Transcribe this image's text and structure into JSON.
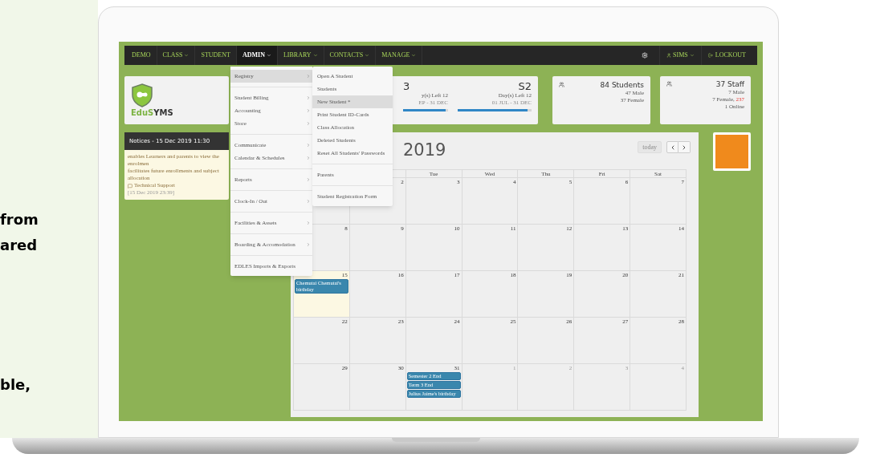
{
  "marketing_text": [
    "from",
    "ared",
    "ble,"
  ],
  "nav": {
    "items": [
      {
        "label": "DEMO",
        "dropdown": false,
        "selected": false
      },
      {
        "label": "CLASS",
        "dropdown": true,
        "selected": false
      },
      {
        "label": "STUDENT",
        "dropdown": false,
        "selected": false
      },
      {
        "label": "ADMIN",
        "dropdown": true,
        "selected": true
      },
      {
        "label": "LIBRARY",
        "dropdown": true,
        "selected": false
      },
      {
        "label": "CONTACTS",
        "dropdown": true,
        "selected": false
      },
      {
        "label": "MANAGE",
        "dropdown": true,
        "selected": false
      }
    ],
    "user": "SIMS",
    "logout": "LOCKOUT"
  },
  "logo_text_parts": [
    "EduS",
    "YMS"
  ],
  "semesters": [
    {
      "name": "3",
      "days_left": "y(s) Left 12",
      "range": "EP - 31 DEC",
      "level": 0.95
    },
    {
      "name": "S2",
      "days_left": "Day(s) Left 12",
      "range": "01 JUL - 31 DEC",
      "level": 0.95
    }
  ],
  "students": {
    "title": "84 Students",
    "lines": [
      "47 Male",
      "37 Female"
    ]
  },
  "staff": {
    "title": "37 Staff",
    "male": "7 Male",
    "female": "7 Female,",
    "female_alert": "237",
    "online": "1 Online"
  },
  "notices": {
    "title": "Notices - 15 Dec 2019 11:30",
    "lines": [
      "enables Learners and parents to view the enrolmen",
      "facilitates future enrollments and subject allocation"
    ],
    "author": "Technical Support",
    "time": "[15 Dec 2019 23:39]"
  },
  "calendar": {
    "title": "2019",
    "today_button": "today",
    "weekdays": [
      "Tue",
      "Wed",
      "Thu",
      "Fri",
      "Sat"
    ],
    "weeks": [
      [
        {
          "day": "2",
          "today": false,
          "muted": false
        },
        {
          "day": "3",
          "today": false,
          "muted": false
        },
        {
          "day": "4",
          "today": false,
          "muted": false
        },
        {
          "day": "5",
          "today": false,
          "muted": false
        },
        {
          "day": "6",
          "today": false,
          "muted": false
        },
        {
          "day": "7",
          "today": false,
          "muted": false
        }
      ],
      [
        {
          "day": "8",
          "today": false,
          "muted": false
        },
        {
          "day": "9",
          "today": false,
          "muted": false
        },
        {
          "day": "10",
          "today": false,
          "muted": false
        },
        {
          "day": "11",
          "today": false,
          "muted": false
        },
        {
          "day": "12",
          "today": false,
          "muted": false
        },
        {
          "day": "13",
          "today": false,
          "muted": false
        },
        {
          "day": "14",
          "today": false,
          "muted": false
        }
      ],
      [
        {
          "day": "15",
          "today": true,
          "muted": false,
          "events": [
            "Chemutai Chemutai's birthday"
          ]
        },
        {
          "day": "16",
          "today": false,
          "muted": false
        },
        {
          "day": "17",
          "today": false,
          "muted": false
        },
        {
          "day": "18",
          "today": false,
          "muted": false
        },
        {
          "day": "19",
          "today": false,
          "muted": false
        },
        {
          "day": "20",
          "today": false,
          "muted": false
        },
        {
          "day": "21",
          "today": false,
          "muted": false
        }
      ],
      [
        {
          "day": "22",
          "today": false,
          "muted": false
        },
        {
          "day": "23",
          "today": false,
          "muted": false
        },
        {
          "day": "24",
          "today": false,
          "muted": false
        },
        {
          "day": "25",
          "today": false,
          "muted": false
        },
        {
          "day": "26",
          "today": false,
          "muted": false
        },
        {
          "day": "27",
          "today": false,
          "muted": false
        },
        {
          "day": "28",
          "today": false,
          "muted": false
        }
      ],
      [
        {
          "day": "29",
          "today": false,
          "muted": false
        },
        {
          "day": "30",
          "today": false,
          "muted": false
        },
        {
          "day": "31",
          "today": false,
          "muted": false,
          "events": [
            "Semester 2 End",
            "Term 3 End",
            "Julius Jaime's birthday"
          ]
        },
        {
          "day": "1",
          "today": false,
          "muted": true
        },
        {
          "day": "2",
          "today": false,
          "muted": true
        },
        {
          "day": "3",
          "today": false,
          "muted": true
        },
        {
          "day": "4",
          "today": false,
          "muted": true
        }
      ]
    ]
  },
  "admin_menu": [
    [
      {
        "label": "Registry",
        "submenu": true,
        "selected": true
      }
    ],
    [
      {
        "label": "Student Billing",
        "submenu": true,
        "selected": false
      },
      {
        "label": "Accounting",
        "submenu": true,
        "selected": false
      },
      {
        "label": "Store",
        "submenu": true,
        "selected": false
      }
    ],
    [
      {
        "label": "Communicate",
        "submenu": true,
        "selected": false
      },
      {
        "label": "Calendar & Schedules",
        "submenu": true,
        "selected": false
      }
    ],
    [
      {
        "label": "Reports",
        "submenu": true,
        "selected": false
      }
    ],
    [
      {
        "label": "Clock-In / Out",
        "submenu": true,
        "selected": false
      }
    ],
    [
      {
        "label": "Facilities & Assets",
        "submenu": true,
        "selected": false
      }
    ],
    [
      {
        "label": "Boarding & Accomodation",
        "submenu": true,
        "selected": false
      }
    ],
    [
      {
        "label": "EDLES Imports & Exports",
        "selected": false
      }
    ]
  ],
  "registry_menu": [
    [
      {
        "label": "Open A Student",
        "selected": false
      },
      {
        "label": "Students",
        "selected": false
      },
      {
        "label": "New Student *",
        "selected": true
      },
      {
        "label": "Print Student ID-Cards",
        "selected": false
      },
      {
        "label": "Class Allocation",
        "selected": false
      },
      {
        "label": "Deleted Students",
        "selected": false
      },
      {
        "label": "Reset All Students' Passwords",
        "selected": false
      }
    ],
    [
      {
        "label": "Parents",
        "selected": false
      }
    ],
    [
      {
        "label": "Student Registration Form",
        "selected": false
      }
    ]
  ]
}
